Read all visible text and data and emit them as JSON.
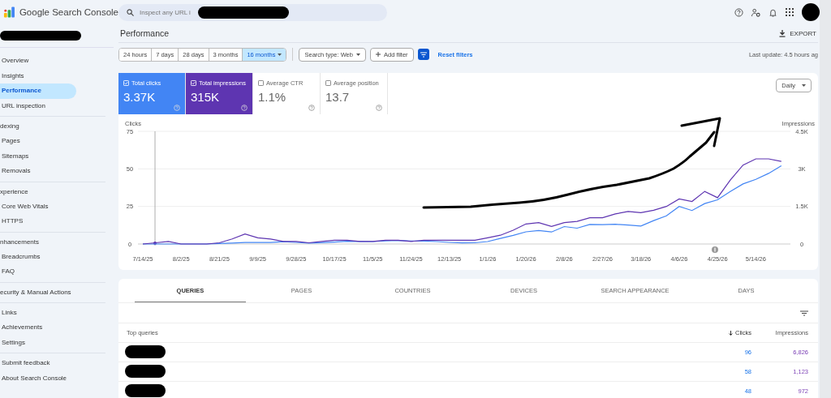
{
  "app": {
    "title": "Google Search Console"
  },
  "search": {
    "placeholder": "Inspect any URL i"
  },
  "sidebar": {
    "sections": [
      {
        "items": [
          {
            "label": "Overview",
            "selected": false
          },
          {
            "label": "Insights",
            "selected": false
          },
          {
            "label": "Performance",
            "selected": true
          },
          {
            "label": "URL inspection",
            "selected": false
          }
        ]
      },
      {
        "heading": "dexing",
        "items": [
          {
            "label": "Pages",
            "selected": false
          },
          {
            "label": "Sitemaps",
            "selected": false
          },
          {
            "label": "Removals",
            "selected": false
          }
        ]
      },
      {
        "heading": "xperience",
        "items": [
          {
            "label": "Core Web Vitals",
            "selected": false
          },
          {
            "label": "HTTPS",
            "selected": false
          }
        ]
      },
      {
        "heading": "nhancements",
        "items": [
          {
            "label": "Breadcrumbs",
            "selected": false
          },
          {
            "label": "FAQ",
            "selected": false
          }
        ]
      },
      {
        "heading": "ecurity & Manual Actions"
      },
      {
        "items": [
          {
            "label": "Links",
            "selected": false
          },
          {
            "label": "Achievements",
            "selected": false
          },
          {
            "label": "Settings",
            "selected": false
          }
        ]
      },
      {
        "items": [
          {
            "label": "Submit feedback",
            "selected": false
          },
          {
            "label": "About Search Console",
            "selected": false
          }
        ]
      }
    ]
  },
  "page": {
    "title": "Performance",
    "export": "EXPORT"
  },
  "date_ranges": [
    {
      "label": "24 hours",
      "selected": false
    },
    {
      "label": "7 days",
      "selected": false
    },
    {
      "label": "28 days",
      "selected": false
    },
    {
      "label": "3 months",
      "selected": false
    },
    {
      "label": "16 months",
      "selected": true
    }
  ],
  "filters": {
    "search_type": "Search type: Web",
    "add_filter": "Add filter",
    "reset": "Reset filters",
    "last_update": "Last update: 4.5 hours ag"
  },
  "metrics": [
    {
      "label": "Total clicks",
      "value": "3.37K",
      "selected": true,
      "color": "#4285f4"
    },
    {
      "label": "Total impressions",
      "value": "315K",
      "selected": true,
      "color": "#5e35b1"
    },
    {
      "label": "Average CTR",
      "value": "1.1%",
      "selected": false
    },
    {
      "label": "Average position",
      "value": "13.7",
      "selected": false
    }
  ],
  "granularity": "Daily",
  "chart_data": {
    "type": "line",
    "ylabel": "Clicks",
    "y2label": "Impressions",
    "categories": [
      "7/14/25",
      null,
      null,
      "8/2/25",
      null,
      null,
      "8/21/25",
      null,
      null,
      "9/9/25",
      null,
      null,
      "9/28/25",
      null,
      null,
      "10/17/25",
      null,
      null,
      "11/5/25",
      null,
      null,
      "11/24/25",
      null,
      null,
      "12/13/25",
      null,
      null,
      "1/1/26",
      null,
      null,
      "1/20/26",
      null,
      null,
      "2/8/26",
      null,
      null,
      "2/27/26",
      null,
      null,
      "3/18/26",
      null,
      null,
      "4/6/26",
      null,
      null,
      "4/25/26",
      null,
      null,
      "5/14/26",
      null,
      null
    ],
    "ylim": [
      0,
      75
    ],
    "yticks": [
      0,
      25,
      50,
      75
    ],
    "y2lim": [
      0,
      4500
    ],
    "y2ticks": [
      {
        "value": 0,
        "label": "0"
      },
      {
        "value": 1500,
        "label": "1.5K"
      },
      {
        "value": 3000,
        "label": "3K"
      },
      {
        "value": 4500,
        "label": "4.5K"
      }
    ],
    "series": [
      {
        "color": "#4285f4",
        "values": [
          0,
          0,
          0,
          0,
          0,
          0,
          0.3,
          0.6,
          1,
          1,
          1,
          1.5,
          1.1,
          0.6,
          0.9,
          1.3,
          1.8,
          1.7,
          1.6,
          2.1,
          2.4,
          2,
          2,
          1.6,
          1.1,
          0.7,
          0.8,
          1.6,
          3.7,
          5.7,
          8.1,
          9,
          8,
          11.6,
          10.5,
          13,
          12.9,
          13.1,
          12.6,
          12,
          15.6,
          18.7,
          25,
          22.3,
          26.9,
          29.4,
          34.9,
          40,
          43,
          47,
          52
        ]
      },
      {
        "color": "#5e35b1",
        "axis": "y2",
        "values": [
          0,
          50,
          100,
          0,
          0,
          0,
          50,
          200,
          400,
          250,
          200,
          100,
          100,
          50,
          100,
          150,
          150,
          100,
          100,
          150,
          150,
          100,
          150,
          150,
          150,
          150,
          150,
          250,
          350,
          550,
          800,
          850,
          700,
          850,
          900,
          1050,
          1050,
          1200,
          1300,
          1250,
          1350,
          1500,
          1800,
          1700,
          2100,
          1850,
          2550,
          3150,
          3400,
          3400,
          3300
        ]
      }
    ]
  },
  "tabs": [
    {
      "label": "QUERIES",
      "selected": true
    },
    {
      "label": "PAGES",
      "selected": false
    },
    {
      "label": "COUNTRIES",
      "selected": false
    },
    {
      "label": "DEVICES",
      "selected": false
    },
    {
      "label": "SEARCH APPEARANCE",
      "selected": false
    },
    {
      "label": "DAYS",
      "selected": false
    }
  ],
  "table": {
    "columns": [
      "Top queries",
      "Clicks",
      "Impressions"
    ],
    "rows": [
      {
        "clicks": "96",
        "impressions": "6,826"
      },
      {
        "clicks": "58",
        "impressions": "1,123"
      },
      {
        "clicks": "48",
        "impressions": "972"
      }
    ]
  }
}
